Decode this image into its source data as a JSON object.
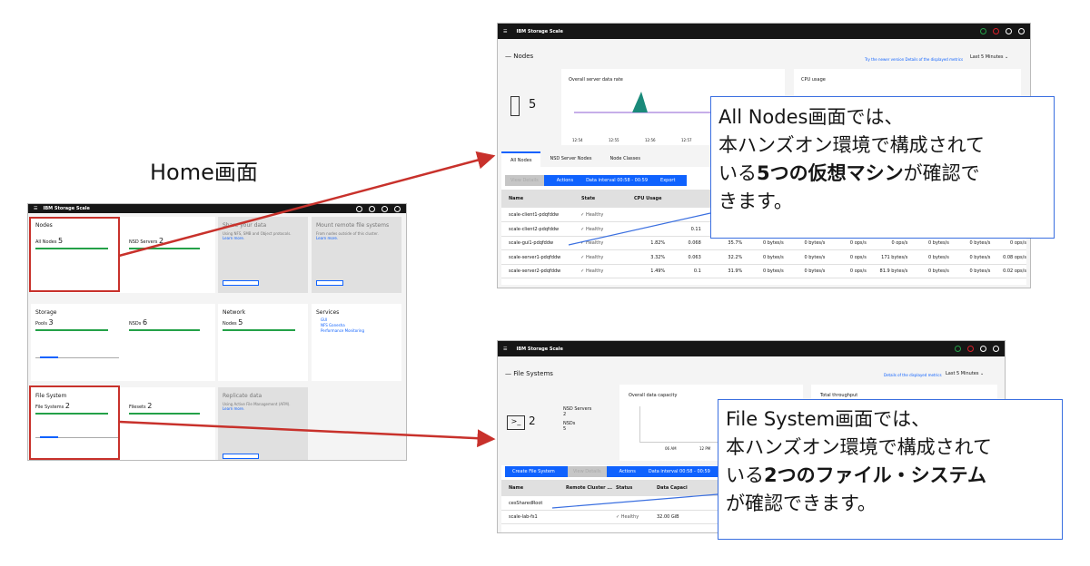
{
  "home": {
    "label": "Home画面",
    "app": "IBM Storage Scale",
    "nodes_title": "Nodes",
    "all_nodes": "All Nodes",
    "all_nodes_n": "5",
    "nsd_servers": "NSD Servers",
    "nsd_servers_n": "2",
    "share_title": "Share your data",
    "share_desc": "Using NFS, SMB and Object protocols.",
    "learn": "Learn more.",
    "mount_title": "Mount remote file systems",
    "mount_desc": "From nodes outside of this cluster.",
    "storage_title": "Storage",
    "pools": "Pools",
    "pools_n": "3",
    "nsds": "NSDs",
    "nsds_n": "6",
    "network_title": "Network",
    "nodes_lbl": "Nodes",
    "nodes_n": "5",
    "services_title": "Services",
    "svc1": "GUI",
    "svc2": "NFS Ganesha",
    "svc3": "Performance Monitoring",
    "fs_title": "File System",
    "file_systems": "File Systems",
    "fs_n": "2",
    "filesets": "Filesets",
    "filesets_n": "2",
    "replicate_title": "Replicate data",
    "replicate_desc": "Using Active File Management (AFM)."
  },
  "nodes": {
    "app": "IBM Storage Scale",
    "title": "Nodes",
    "links": "Try the newer version  Details of the displayed metrics",
    "range": "Last 5 Minutes",
    "count": "5",
    "chart1": "Overall server data rate",
    "chart2": "CPU usage",
    "ticks": [
      "12:54",
      "12:55",
      "12:56",
      "12:57"
    ],
    "tabs": [
      "All Nodes",
      "NSD Server Nodes",
      "Node Classes"
    ],
    "toolbar": {
      "view": "View Details",
      "actions": "Actions",
      "interval": "Data interval 00:58 - 00:59",
      "export": "Export"
    },
    "cols": [
      "Name",
      "State",
      "CPU Usage"
    ],
    "rows": [
      {
        "name": "scale-client1-pdqfddw",
        "state": "Healthy",
        "cpu": "",
        "load": "",
        "mem": "",
        "net": "",
        "s1": "",
        "s2": "",
        "s3": "",
        "s4": "",
        "s5": "",
        "s6": ""
      },
      {
        "name": "scale-client2-pdqfddw",
        "state": "Healthy",
        "cpu": "",
        "load": "0.11",
        "mem": "",
        "net": "",
        "s1": "",
        "s2": "",
        "s3": "",
        "s4": "",
        "s5": "",
        "s6": ""
      },
      {
        "name": "scale-gui1-pdqfddw",
        "state": "Healthy",
        "cpu": "1.82%",
        "load": "0.068",
        "mem": "35.7%",
        "net": "0 bytes/s",
        "s1": "0 bytes/s",
        "s2": "0 ops/s",
        "s3": "0 ops/s",
        "s4": "0 bytes/s",
        "s5": "0 bytes/s",
        "s6": "0 ops/s"
      },
      {
        "name": "scale-server1-pdqfddw",
        "state": "Healthy",
        "cpu": "3.32%",
        "load": "0.063",
        "mem": "32.2%",
        "net": "0 bytes/s",
        "s1": "0 bytes/s",
        "s2": "0 ops/s",
        "s3": "171 bytes/s",
        "s4": "0 bytes/s",
        "s5": "0 bytes/s",
        "s6": "0.08 ops/s"
      },
      {
        "name": "scale-server2-pdqfddw",
        "state": "Healthy",
        "cpu": "1.49%",
        "load": "0.1",
        "mem": "31.9%",
        "net": "0 bytes/s",
        "s1": "0 bytes/s",
        "s2": "0 ops/s",
        "s3": "81.9 bytes/s",
        "s4": "0 bytes/s",
        "s5": "0 bytes/s",
        "s6": "0.02 ops/s"
      }
    ]
  },
  "fs": {
    "app": "IBM Storage Scale",
    "title": "File Systems",
    "links": "Details of the displayed metrics",
    "range": "Last 5 Minutes",
    "count": "2",
    "nsd_servers": "NSD Servers",
    "nsd_servers_n": "2",
    "nsds": "NSDs",
    "nsds_n": "5",
    "chart1": "Overall data capacity",
    "chart2": "Total throughput",
    "ticks": [
      "06 AM",
      "12 PM"
    ],
    "toolbar": {
      "create": "Create File System",
      "view": "View Details",
      "actions": "Actions",
      "interval": "Data interval 00:58 - 00:59"
    },
    "cols": [
      "Name",
      "Remote Cluster ...",
      "Status",
      "Data Capaci"
    ],
    "rows": [
      {
        "name": "cesSharedRoot",
        "status": "",
        "cap": ""
      },
      {
        "name": "scale-lab-fs1",
        "status": "Healthy",
        "cap": "32.00 GiB"
      }
    ]
  },
  "callouts": {
    "c1_a": "All Nodes画面では、",
    "c1_b": "本ハンズオン環境で構成されて",
    "c1_c1": "いる",
    "c1_c2": "5つの仮想マシン",
    "c1_c3": "が確認で",
    "c1_d": "きます。",
    "c2_a": "File System画面では、",
    "c2_b": "本ハンズオン環境で構成されて",
    "c2_c1": "いる",
    "c2_c2": "2つのファイル・システム",
    "c2_d": "が確認できます。"
  },
  "colors": {
    "accent": "#0f62fe",
    "healthy": "#24a148",
    "arrow": "#c8312b",
    "callout_border": "#3a6fe0"
  }
}
